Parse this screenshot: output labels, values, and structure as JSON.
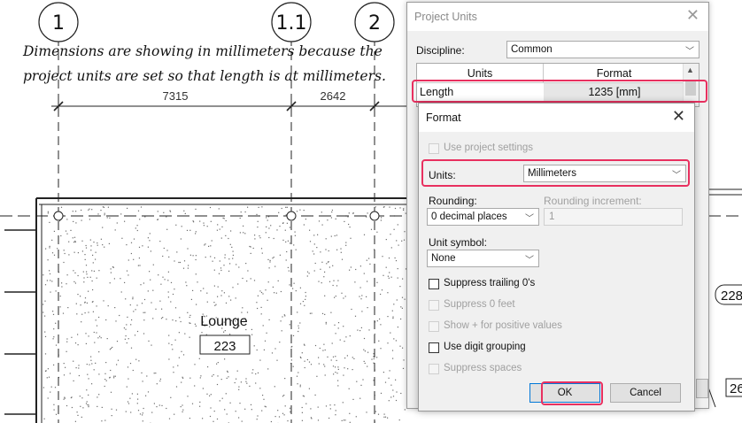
{
  "drawing": {
    "grids": [
      {
        "label": "1"
      },
      {
        "label": "1.1"
      },
      {
        "label": "2"
      }
    ],
    "dimensions": [
      "7315",
      "2642"
    ],
    "room": {
      "name": "Lounge",
      "number": "223"
    },
    "partial_tags": [
      "228",
      "26"
    ],
    "colors": {
      "line": "#222222",
      "speckle": "#6b6b6b",
      "highlight": "#e8305f"
    }
  },
  "annotation": {
    "lines": [
      "Dimensions are showing in millimeters because the",
      "project units are set so that length is at millimeters."
    ]
  },
  "project_units": {
    "title": "Project Units",
    "discipline_label": "Discipline:",
    "discipline_value": "Common",
    "table": {
      "headers": [
        "Units",
        "Format"
      ],
      "rows": [
        {
          "unit": "Length",
          "format": "1235 [mm]"
        }
      ]
    }
  },
  "format_dialog": {
    "title": "Format",
    "use_project_settings": "Use project settings",
    "units_label": "Units:",
    "units_value": "Millimeters",
    "rounding_label": "Rounding:",
    "rounding_value": "0 decimal places",
    "rounding_increment_label": "Rounding increment:",
    "rounding_increment_value": "1",
    "unit_symbol_label": "Unit symbol:",
    "unit_symbol_value": "None",
    "options": {
      "suppress_trailing": "Suppress trailing 0's",
      "suppress_feet": "Suppress 0 feet",
      "show_plus": "Show + for positive values",
      "digit_grouping": "Use digit grouping",
      "suppress_spaces": "Suppress spaces"
    },
    "ok_label": "OK",
    "cancel_label": "Cancel"
  }
}
